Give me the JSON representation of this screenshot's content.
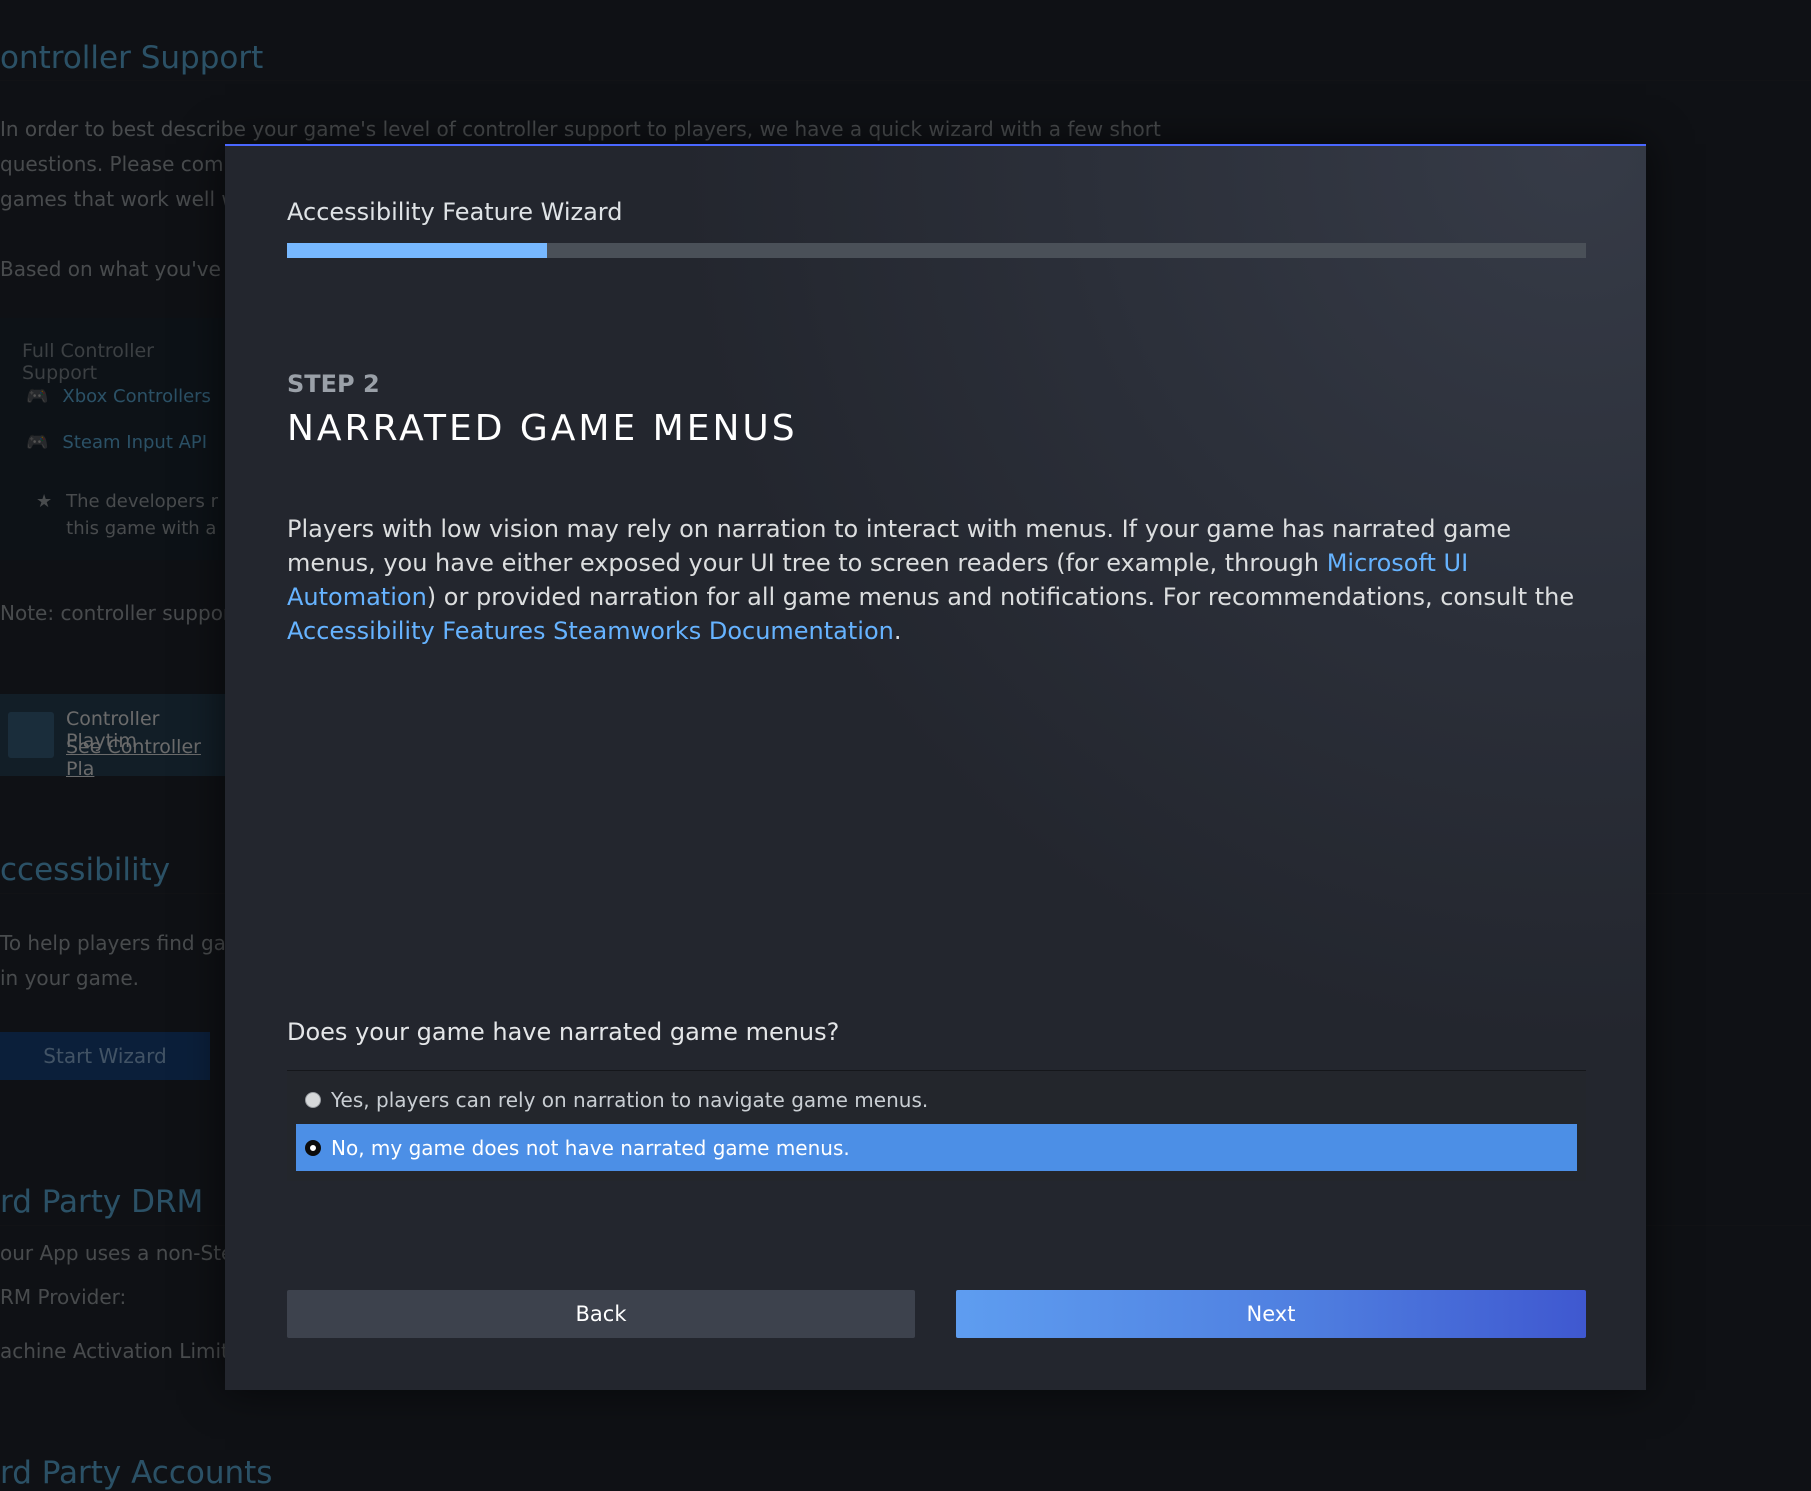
{
  "background": {
    "controller_title": "ontroller Support",
    "intro_lines": [
      "In order to best describe your game's level of controller support to players, we have a quick wizard with a few short",
      "questions. Please comp",
      "games that work well w"
    ],
    "based_on": "Based on what you've t",
    "panel": {
      "header": "Full Controller Support",
      "rows": [
        "Xbox Controllers",
        "Steam Input API"
      ],
      "note_line1": "The developers r",
      "note_line2": "this game with a"
    },
    "controller_note": "Note: controller suppor",
    "playtime_card": {
      "title": "Controller Playtim",
      "link": "See Controller Pla"
    },
    "accessibility_title": "ccessibility",
    "accessibility_lines": [
      "To help players find gar",
      "in your game."
    ],
    "start_wizard": "Start Wizard",
    "drm_title": "rd Party DRM",
    "drm_line": "our App uses a non-Stea",
    "drm_provider": "RM Provider:",
    "activation_limit": "achine Activation Limit:",
    "accounts_title": "rd Party Accounts"
  },
  "modal": {
    "title": "Accessibility Feature Wizard",
    "progress": 0.2,
    "step_label": "STEP 2",
    "step_title": "NARRATED GAME MENUS",
    "description": {
      "part1": "Players with low vision may rely on narration to interact with menus. If your game has narrated game menus, you have either exposed your UI tree to screen readers (for example, through ",
      "link1": "Microsoft UI Automation",
      "part2": ") or provided narration for all game menus and notifications. For recommendations, consult the ",
      "link2": "Accessibility Features Steamworks Documentation",
      "part3": "."
    },
    "question": "Does your game have narrated game menus?",
    "options": [
      {
        "label": "Yes, players can rely on narration to navigate game menus.",
        "selected": false
      },
      {
        "label": "No, my game does not have narrated game menus.",
        "selected": true
      }
    ],
    "back_label": "Back",
    "next_label": "Next"
  },
  "colors": {
    "accent": "#4c8fe6",
    "link": "#66b3ff",
    "progress_fill": "#77b8ff",
    "modal_top_border": "#4a67ff"
  }
}
